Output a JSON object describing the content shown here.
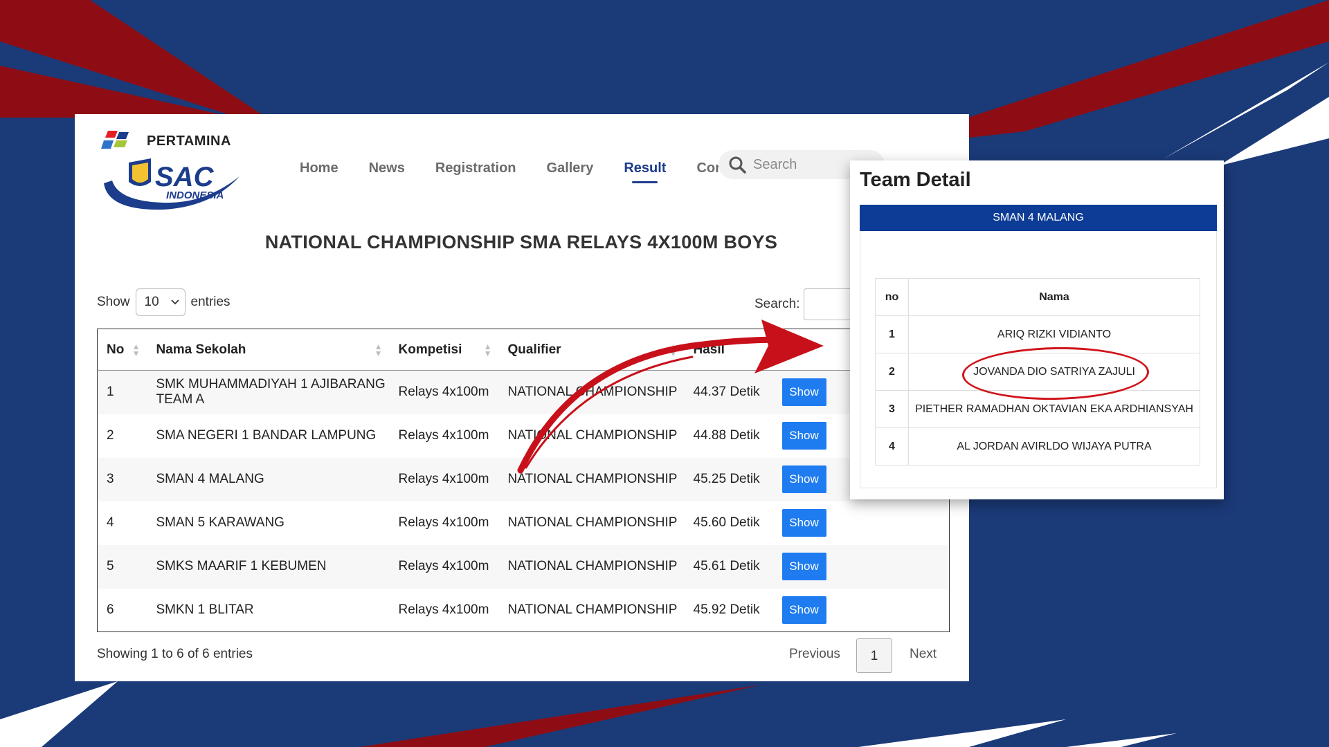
{
  "brand": {
    "sponsor": "PERTAMINA",
    "logo_text": "SAC",
    "logo_sub": "INDONESIA"
  },
  "nav": {
    "items": [
      "Home",
      "News",
      "Registration",
      "Gallery",
      "Result",
      "Contact"
    ],
    "active": "Result",
    "search_placeholder": "Search"
  },
  "page_title": "NATIONAL CHAMPIONSHIP SMA RELAYS 4X100M BOYS",
  "length_menu": {
    "show_label": "Show",
    "value": "10",
    "entries_label": "entries"
  },
  "table_search": {
    "label": "Search:"
  },
  "table": {
    "headers": [
      "No",
      "Nama Sekolah",
      "Kompetisi",
      "Qualifier",
      "Hasil",
      "Tim"
    ],
    "rows": [
      [
        "1",
        "SMK MUHAMMADIYAH 1 AJIBARANG TEAM A",
        "Relays 4x100m",
        "NATIONAL CHAMPIONSHIP",
        "44.37 Detik",
        "Show"
      ],
      [
        "2",
        "SMA NEGERI 1 BANDAR LAMPUNG",
        "Relays 4x100m",
        "NATIONAL CHAMPIONSHIP",
        "44.88 Detik",
        "Show"
      ],
      [
        "3",
        "SMAN 4 MALANG",
        "Relays 4x100m",
        "NATIONAL CHAMPIONSHIP",
        "45.25 Detik",
        "Show"
      ],
      [
        "4",
        "SMAN 5 KARAWANG",
        "Relays 4x100m",
        "NATIONAL CHAMPIONSHIP",
        "45.60 Detik",
        "Show"
      ],
      [
        "5",
        "SMKS MAARIF 1 KEBUMEN",
        "Relays 4x100m",
        "NATIONAL CHAMPIONSHIP",
        "45.61 Detik",
        "Show"
      ],
      [
        "6",
        "SMKN 1 BLITAR",
        "Relays 4x100m",
        "NATIONAL CHAMPIONSHIP",
        "45.92 Detik",
        "Show"
      ]
    ]
  },
  "pager": {
    "info": "Showing 1 to 6 of 6 entries",
    "previous": "Previous",
    "page": "1",
    "next": "Next"
  },
  "modal": {
    "title": "Team Detail",
    "team": "SMAN 4 MALANG",
    "headers": [
      "no",
      "Nama"
    ],
    "members": [
      [
        "1",
        "ARIQ RIZKI VIDIANTO"
      ],
      [
        "2",
        "JOVANDA DIO SATRIYA ZAJULI"
      ],
      [
        "3",
        "PIETHER RAMADHAN OKTAVIAN EKA ARDHIANSYAH"
      ],
      [
        "4",
        "AL JORDAN AVIRLDO WIJAYA PUTRA"
      ]
    ]
  },
  "colors": {
    "background": "#1b3a78",
    "accent_red": "#c8101a",
    "brand_blue": "#0d3c96",
    "button_blue": "#1e7cf0"
  }
}
